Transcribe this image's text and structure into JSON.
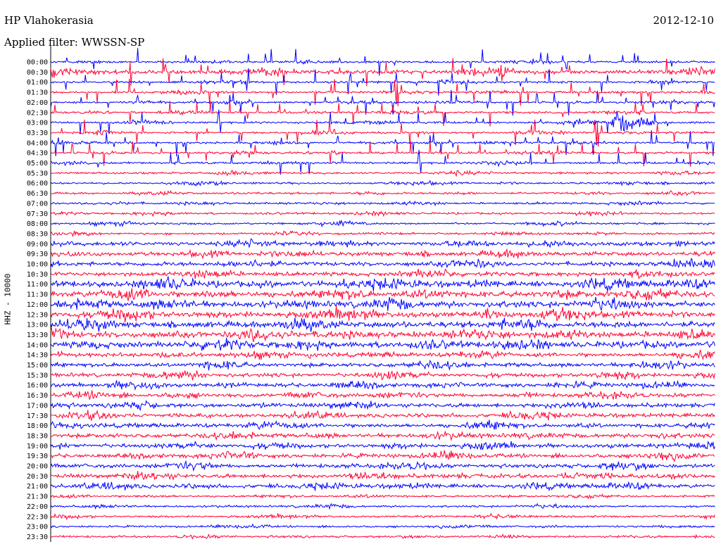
{
  "header": {
    "station": "HP Vlahokerasia",
    "date": "2012-12-10",
    "filter": "Applied filter: WWSSN-SP"
  },
  "chart_data": {
    "type": "line",
    "title": "HP Vlahokerasia",
    "subtitle": "Applied filter: WWSSN-SP",
    "ylabel": "HHZ - 10000",
    "xlabel": "",
    "row_labels": [
      "00:00",
      "00:30",
      "01:00",
      "01:30",
      "02:00",
      "02:30",
      "03:00",
      "03:30",
      "04:00",
      "04:30",
      "05:00",
      "05:30",
      "06:00",
      "06:30",
      "07:00",
      "07:30",
      "08:00",
      "08:30",
      "09:00",
      "09:30",
      "10:00",
      "10:30",
      "11:00",
      "11:30",
      "12:00",
      "12:30",
      "13:00",
      "13:30",
      "14:00",
      "14:30",
      "15:00",
      "15:30",
      "16:00",
      "16:30",
      "17:00",
      "17:30",
      "18:00",
      "18:30",
      "19:00",
      "19:30",
      "20:00",
      "20:30",
      "21:00",
      "21:30",
      "22:00",
      "22:30",
      "23:00",
      "23:30"
    ],
    "colors": [
      "#0000ff",
      "#ff0033"
    ],
    "noise_level": [
      1,
      2,
      1,
      1,
      1,
      1,
      1,
      1,
      1,
      1,
      1,
      1,
      1,
      1,
      1,
      1,
      1,
      1,
      2,
      2,
      2,
      2,
      3,
      3,
      3,
      3,
      3,
      3,
      3,
      2,
      2,
      2,
      2,
      2,
      2,
      2,
      2,
      2,
      2,
      2,
      2,
      2,
      2,
      1,
      1,
      1,
      1,
      1
    ],
    "events": [
      {
        "row": 6,
        "minute": 25.3,
        "amplitude": 22,
        "duration_min": 2.5
      },
      {
        "row": 16,
        "minute": 13.0,
        "amplitude": 14,
        "duration_min": 0.6
      },
      {
        "row": 25,
        "minute": 19.6,
        "amplitude": 18,
        "duration_min": 1.0
      },
      {
        "row": 29,
        "minute": 11.6,
        "amplitude": 10,
        "duration_min": 0.5
      },
      {
        "row": 22,
        "minute": 13.2,
        "amplitude": 9,
        "duration_min": 0.8
      },
      {
        "row": 27,
        "minute": 12.0,
        "amplitude": 8,
        "duration_min": 0.6
      }
    ],
    "spike_rows": [
      0,
      1,
      2,
      3,
      4,
      5,
      6,
      7,
      8,
      9,
      10
    ],
    "grid": false
  }
}
